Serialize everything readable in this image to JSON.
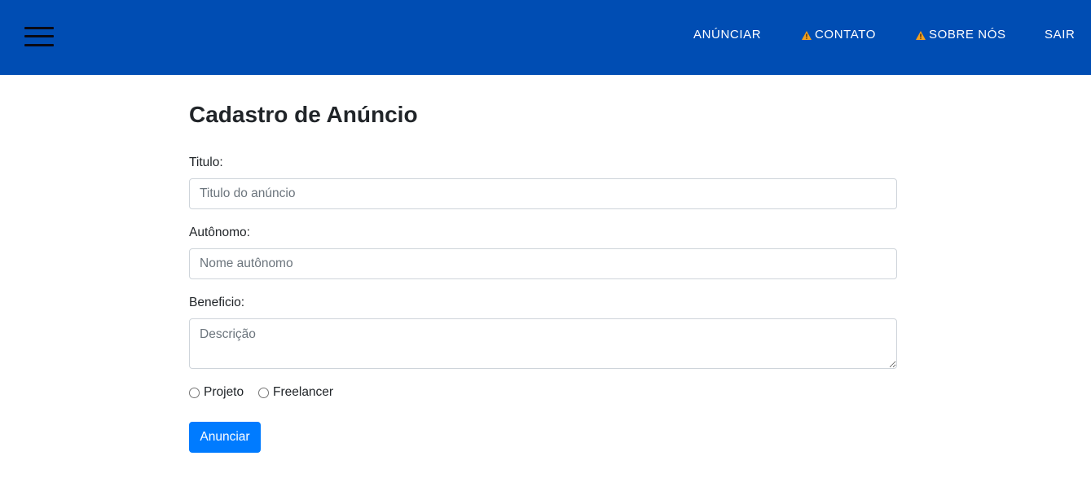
{
  "navbar": {
    "menu_icon": "hamburger-menu-icon",
    "background_color": "#004db3",
    "links": {
      "anunciar": "ANÚNCIAR",
      "contato": "CONTATO",
      "sobre": "SOBRE NÓS",
      "sair": "SAIR"
    },
    "warning_icon": "warning-icon",
    "warning_color": "#f0a020"
  },
  "form": {
    "title": "Cadastro de Anúncio",
    "titulo": {
      "label": "Titulo:",
      "placeholder": "Titulo do anúncio",
      "value": ""
    },
    "autonomo": {
      "label": "Autônomo:",
      "placeholder": "Nome autônomo",
      "value": ""
    },
    "beneficio": {
      "label": "Beneficio:",
      "placeholder": "Descrição",
      "value": ""
    },
    "radios": {
      "projeto": "Projeto",
      "freelancer": "Freelancer"
    },
    "submit_label": "Anunciar",
    "submit_color": "#007bff"
  }
}
